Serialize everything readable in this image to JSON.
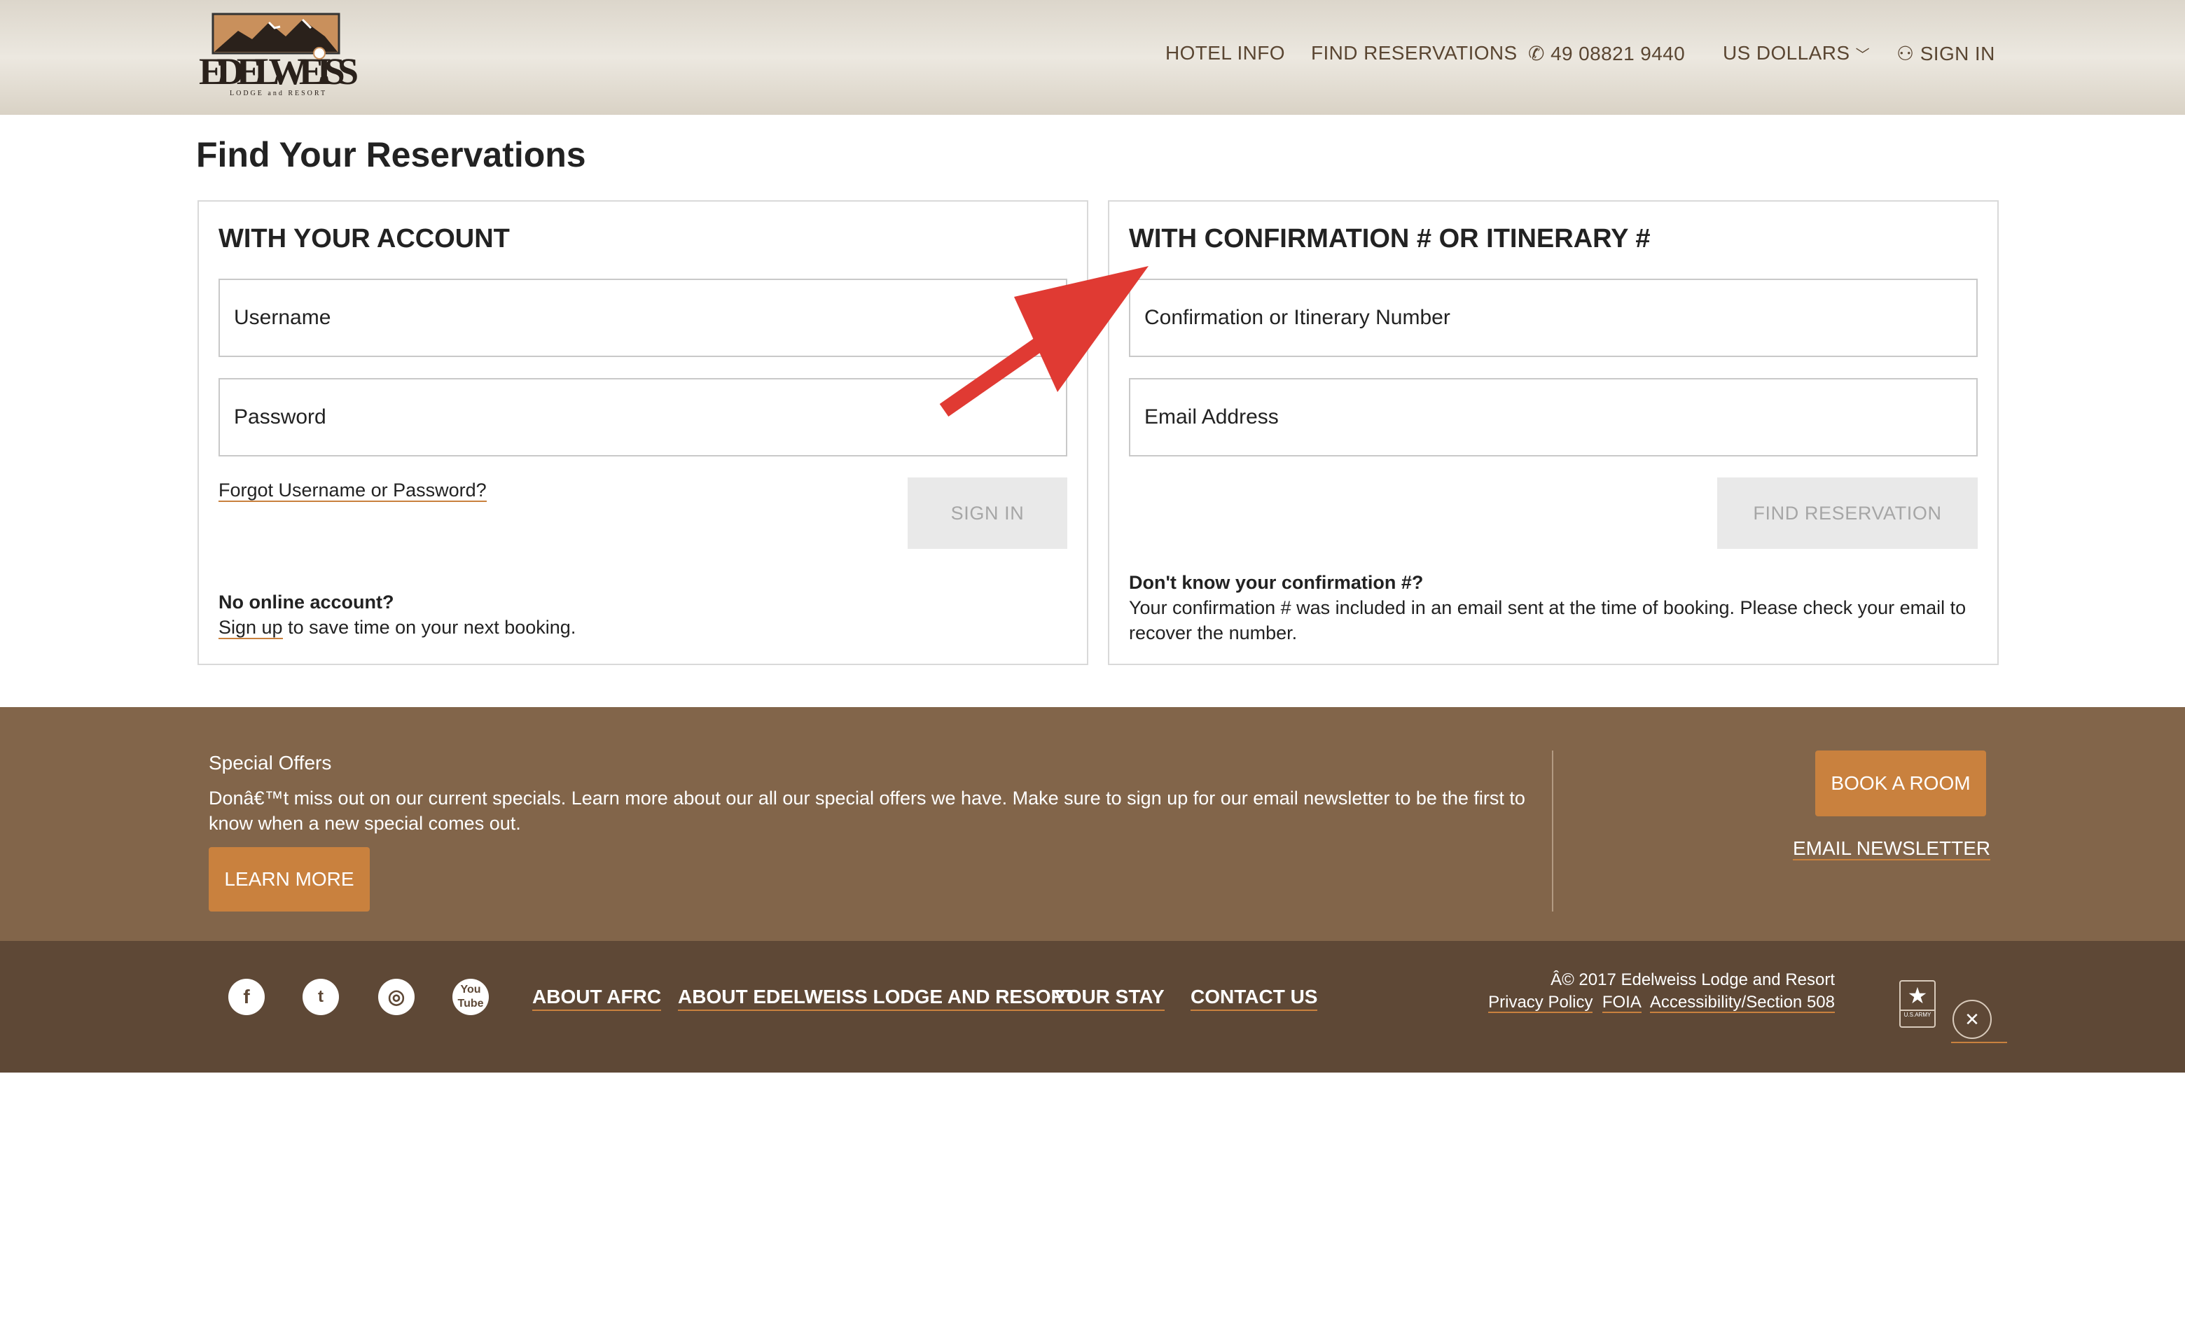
{
  "header": {
    "logo_text": "EDELWEISS",
    "logo_sub": "LODGE and RESORT",
    "nav": [
      {
        "label": "HOTEL INFO"
      },
      {
        "label": "FIND RESERVATIONS"
      },
      {
        "label": "49 08821 9440",
        "icon": "phone-icon"
      },
      {
        "label": "US DOLLARS",
        "icon": "chevron-down-icon"
      },
      {
        "label": "SIGN IN",
        "icon": "user-icon"
      }
    ]
  },
  "page_title": "Find Your Reservations",
  "account": {
    "title": "WITH YOUR ACCOUNT",
    "username_placeholder": "Username",
    "password_placeholder": "Password",
    "forgot": "Forgot Username or Password?",
    "sign_in": "SIGN IN",
    "no_account": "No online account?",
    "sign_up": "Sign up",
    "sign_up_rest": " to save time on your next booking."
  },
  "confirmation": {
    "title": "WITH CONFIRMATION # OR ITINERARY #",
    "number_placeholder": "Confirmation or Itinerary Number",
    "email_placeholder": "Email Address",
    "find": "FIND RESERVATION",
    "help_title": "Don't know your confirmation #?",
    "help_text": "Your confirmation # was included in an email sent at the time of booking. Please check your email to recover the number."
  },
  "annotation": {
    "arrow_color": "#e03a33"
  },
  "offers": {
    "title": "Special Offers",
    "text": "Donâ€™t miss out on our current specials. Learn more about our all our special offers we have. Make sure to sign up for our email newsletter to be the first to know when a new special comes out.",
    "learn_more": "LEARN MORE",
    "book": "BOOK A ROOM",
    "newsletter": "EMAIL NEWSLETTER"
  },
  "footer": {
    "social": [
      "facebook-icon",
      "twitter-icon",
      "instagram-icon",
      "youtube-icon"
    ],
    "links": [
      "ABOUT AFRC",
      "ABOUT EDELWEISS LODGE AND RESORT",
      "YOUR STAY",
      "CONTACT US"
    ],
    "copyright": "Â© 2017 Edelweiss Lodge and Resort",
    "legal": [
      "Privacy Policy",
      "FOIA",
      "Accessibility/Section 508"
    ],
    "army_label": "U.S.ARMY"
  },
  "colors": {
    "accent": "#c9813e",
    "band": "#82654a",
    "footer": "#5e4836"
  }
}
